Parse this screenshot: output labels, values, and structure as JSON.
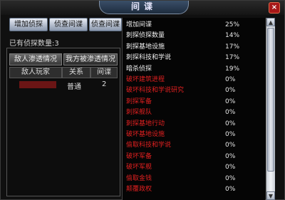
{
  "window": {
    "title": "间谍",
    "close_label": "×"
  },
  "toolbar": {
    "add_spy": "增加侦探",
    "recall_spy": "侦查间谍",
    "check_spy": "侦查间谍"
  },
  "spy_count_text": "已有侦探数量:3",
  "tabs": {
    "enemy": "敌人渗透情况",
    "ours": "我方被渗透情况"
  },
  "table": {
    "headers": [
      "敌人玩家",
      "关系",
      "间谍"
    ],
    "rows": [
      {
        "relation": "普通",
        "spies": "2"
      }
    ]
  },
  "actions": [
    {
      "label": "增加间谍",
      "pct": "25%",
      "style": "normal"
    },
    {
      "label": "刺探侦探数量",
      "pct": "14%",
      "style": "normal"
    },
    {
      "label": "刺探基地设施",
      "pct": "17%",
      "style": "normal"
    },
    {
      "label": "刺探科技和学说",
      "pct": "17%",
      "style": "normal"
    },
    {
      "label": "暗杀侦探",
      "pct": "19%",
      "style": "normal"
    },
    {
      "label": "破坏建筑进程",
      "pct": "0%",
      "style": "red"
    },
    {
      "label": "破坏科技和学说研究",
      "pct": "0%",
      "style": "red"
    },
    {
      "label": "刺探军备",
      "pct": "0%",
      "style": "red"
    },
    {
      "label": "刺探舰队",
      "pct": "0%",
      "style": "red"
    },
    {
      "label": "刺探基地行动",
      "pct": "0%",
      "style": "red"
    },
    {
      "label": "破坏基地设施",
      "pct": "0%",
      "style": "red"
    },
    {
      "label": "偷取科技和学说",
      "pct": "0%",
      "style": "red"
    },
    {
      "label": "破坏军备",
      "pct": "0%",
      "style": "red"
    },
    {
      "label": "破坏军舰",
      "pct": "0%",
      "style": "red"
    },
    {
      "label": "偷取金钱",
      "pct": "0%",
      "style": "red"
    },
    {
      "label": "颠覆政权",
      "pct": "0%",
      "style": "red"
    }
  ],
  "scroll": {
    "up": "▲",
    "down": "▼"
  }
}
